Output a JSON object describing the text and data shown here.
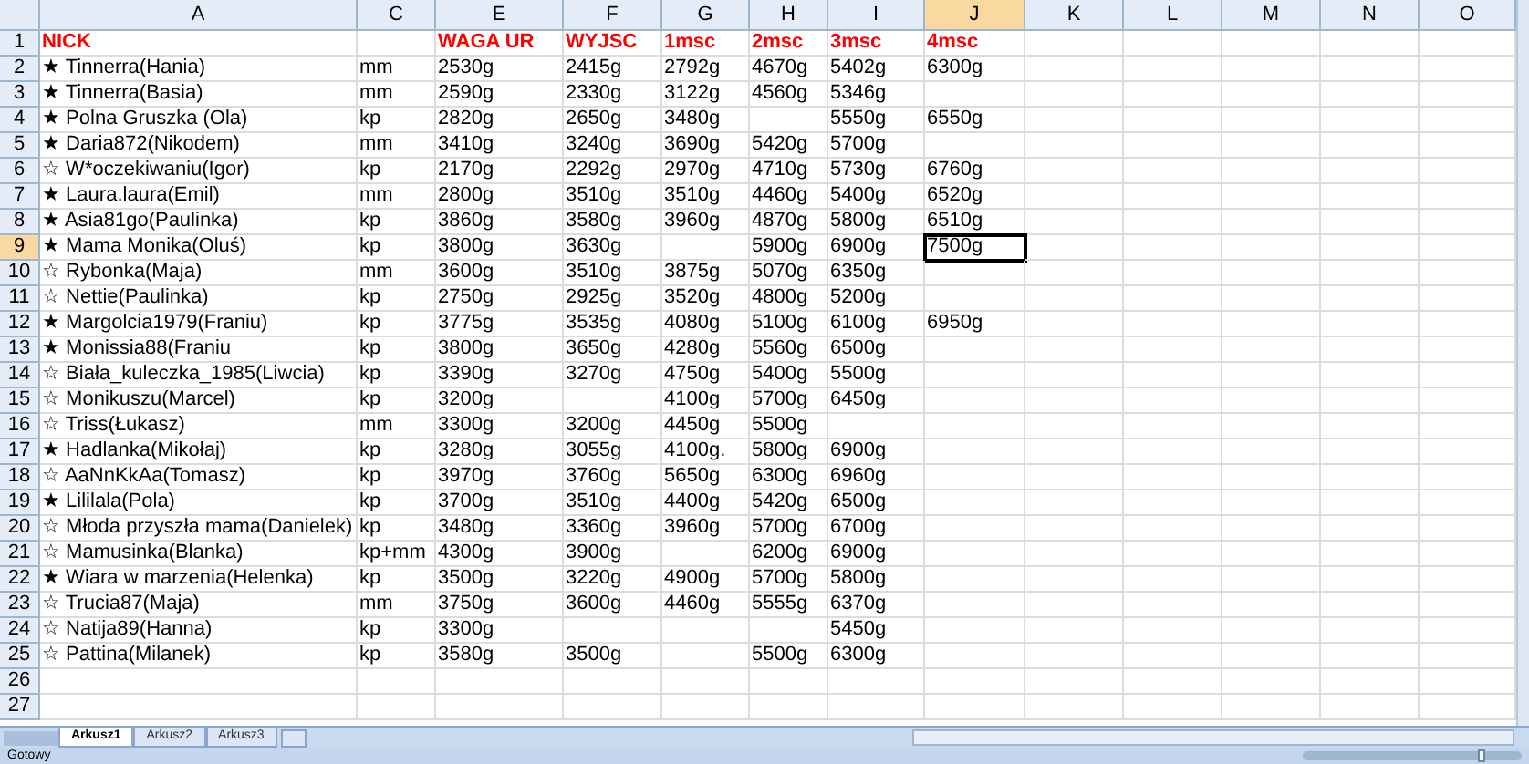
{
  "columns": [
    {
      "label": "A",
      "selected": false
    },
    {
      "label": "C",
      "selected": false
    },
    {
      "label": "E",
      "selected": false
    },
    {
      "label": "F",
      "selected": false
    },
    {
      "label": "G",
      "selected": false
    },
    {
      "label": "H",
      "selected": false
    },
    {
      "label": "I",
      "selected": false
    },
    {
      "label": "J",
      "selected": true
    },
    {
      "label": "K",
      "selected": false
    },
    {
      "label": "L",
      "selected": false
    },
    {
      "label": "M",
      "selected": false
    },
    {
      "label": "N",
      "selected": false
    },
    {
      "label": "O",
      "selected": false
    }
  ],
  "rows": [
    {
      "number": "1",
      "kind": "header",
      "selected": false,
      "cells": [
        "NICK",
        null,
        "WAGA UR",
        "WYJSC",
        "1msc",
        "2msc",
        "3msc",
        "4msc"
      ]
    },
    {
      "number": "2",
      "kind": "data",
      "selected": false,
      "cells": [
        "★ Tinnerra(Hania)",
        "mm",
        "2530g",
        "2415g",
        "2792g",
        "4670g",
        "5402g",
        "6300g"
      ]
    },
    {
      "number": "3",
      "kind": "data",
      "selected": false,
      "cells": [
        "★ Tinnerra(Basia)",
        "mm",
        "2590g",
        "2330g",
        "3122g",
        "4560g",
        "5346g",
        null
      ]
    },
    {
      "number": "4",
      "kind": "data",
      "selected": false,
      "cells": [
        "★ Polna Gruszka (Ola)",
        "kp",
        "2820g",
        "2650g",
        "3480g",
        null,
        "5550g",
        "6550g"
      ]
    },
    {
      "number": "5",
      "kind": "data",
      "selected": false,
      "cells": [
        "★ Daria872(Nikodem)",
        "mm",
        "3410g",
        "3240g",
        "3690g",
        "5420g",
        "5700g",
        null
      ]
    },
    {
      "number": "6",
      "kind": "data",
      "selected": false,
      "cells": [
        "☆ W*oczekiwaniu(Igor)",
        "kp",
        "2170g",
        "2292g",
        "2970g",
        "4710g",
        "5730g",
        "6760g"
      ]
    },
    {
      "number": "7",
      "kind": "data",
      "selected": false,
      "cells": [
        "★ Laura.laura(Emil)",
        "mm",
        "2800g",
        "3510g",
        "3510g",
        "4460g",
        "5400g",
        "6520g"
      ]
    },
    {
      "number": "8",
      "kind": "data",
      "selected": false,
      "cells": [
        "★ Asia81go(Paulinka)",
        "kp",
        "3860g",
        "3580g",
        "3960g",
        "4870g",
        "5800g",
        "6510g"
      ]
    },
    {
      "number": "9",
      "kind": "data",
      "selected": true,
      "cells": [
        "★ Mama Monika(Oluś)",
        "kp",
        "3800g",
        "3630g",
        null,
        "5900g",
        "6900g",
        "7500g"
      ]
    },
    {
      "number": "10",
      "kind": "data",
      "selected": false,
      "cells": [
        "☆ Rybonka(Maja)",
        "mm",
        "3600g",
        "3510g",
        "3875g",
        "5070g",
        "6350g",
        null
      ]
    },
    {
      "number": "11",
      "kind": "data",
      "selected": false,
      "cells": [
        "☆ Nettie(Paulinka)",
        "kp",
        "2750g",
        "2925g",
        "3520g",
        "4800g",
        "5200g",
        null
      ]
    },
    {
      "number": "12",
      "kind": "data",
      "selected": false,
      "cells": [
        "★ Margolcia1979(Franiu)",
        "kp",
        "3775g",
        "3535g",
        "4080g",
        "5100g",
        "6100g",
        "6950g"
      ]
    },
    {
      "number": "13",
      "kind": "data",
      "selected": false,
      "cells": [
        "★ Monissia88(Franiu",
        "kp",
        "3800g",
        "3650g",
        "4280g",
        "5560g",
        "6500g",
        null
      ]
    },
    {
      "number": "14",
      "kind": "data",
      "selected": false,
      "cells": [
        "☆ Biała_kuleczka_1985(Liwcia)",
        "kp",
        "3390g",
        "3270g",
        "4750g",
        "5400g",
        "5500g",
        null
      ]
    },
    {
      "number": "15",
      "kind": "data",
      "selected": false,
      "cells": [
        "☆ Monikuszu(Marcel)",
        "kp",
        "3200g",
        null,
        "4100g",
        "5700g",
        "6450g",
        null
      ]
    },
    {
      "number": "16",
      "kind": "data",
      "selected": false,
      "cells": [
        "☆ Triss(Łukasz)",
        "mm",
        "3300g",
        "3200g",
        "4450g",
        "5500g",
        null,
        null
      ]
    },
    {
      "number": "17",
      "kind": "data",
      "selected": false,
      "cells": [
        "★ Hadlanka(Mikołaj)",
        "kp",
        "3280g",
        "3055g",
        "4100g.",
        "5800g",
        "6900g",
        null
      ]
    },
    {
      "number": "18",
      "kind": "data",
      "selected": false,
      "cells": [
        "☆ AaNnKkAa(Tomasz)",
        "kp",
        "3970g",
        "3760g",
        "5650g",
        "6300g",
        "6960g",
        null
      ]
    },
    {
      "number": "19",
      "kind": "data",
      "selected": false,
      "cells": [
        "★ Lililala(Pola)",
        "kp",
        "3700g",
        "3510g",
        "4400g",
        "5420g",
        "6500g",
        null
      ]
    },
    {
      "number": "20",
      "kind": "data",
      "selected": false,
      "cells": [
        "☆ Młoda przyszła mama(Danielek)",
        "kp",
        "3480g",
        "3360g",
        "3960g",
        "5700g",
        "6700g",
        null
      ]
    },
    {
      "number": "21",
      "kind": "data",
      "selected": false,
      "cells": [
        "☆ Mamusinka(Blanka)",
        "kp+mm",
        "4300g",
        "3900g",
        null,
        "6200g",
        "6900g",
        null
      ]
    },
    {
      "number": "22",
      "kind": "data",
      "selected": false,
      "cells": [
        "★ Wiara w marzenia(Helenka)",
        "kp",
        "3500g",
        "3220g",
        "4900g",
        "5700g",
        "5800g",
        null
      ]
    },
    {
      "number": "23",
      "kind": "data",
      "selected": false,
      "cells": [
        "☆ Trucia87(Maja)",
        "mm",
        "3750g",
        "3600g",
        "4460g",
        "5555g",
        "6370g",
        null
      ]
    },
    {
      "number": "24",
      "kind": "data",
      "selected": false,
      "cells": [
        "☆ Natija89(Hanna)",
        "kp",
        "3300g",
        null,
        null,
        null,
        "5450g",
        null
      ]
    },
    {
      "number": "25",
      "kind": "data",
      "selected": false,
      "cells": [
        "☆ Pattina(Milanek)",
        "kp",
        "3580g",
        "3500g",
        null,
        "5500g",
        "6300g",
        null
      ]
    },
    {
      "number": "26",
      "kind": "data",
      "selected": false,
      "cells": []
    },
    {
      "number": "27",
      "kind": "data",
      "selected": false,
      "cells": []
    }
  ],
  "sheet_tabs": [
    {
      "label": "Arkusz1",
      "selected": true
    },
    {
      "label": "Arkusz2",
      "selected": false
    },
    {
      "label": "Arkusz3",
      "selected": false
    }
  ],
  "status_bar": {
    "text": "Gotowy"
  },
  "zoom_slider": {
    "level": 0.82
  }
}
